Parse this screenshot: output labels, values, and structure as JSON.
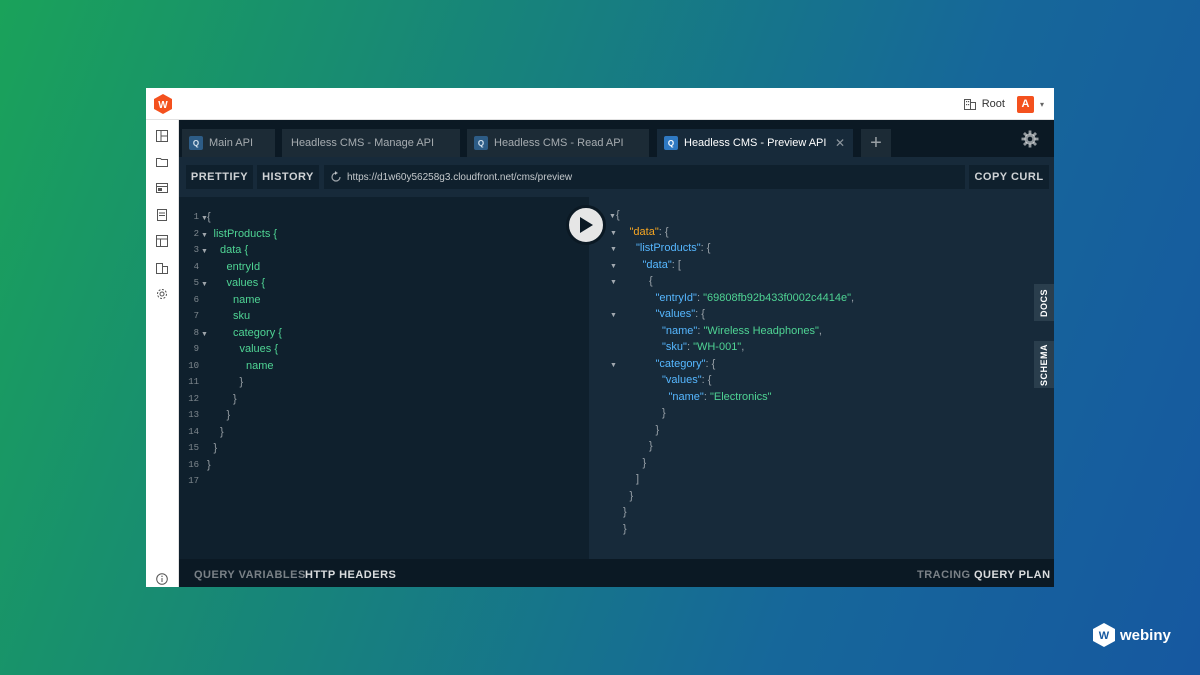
{
  "topbar": {
    "tenant_label": "Root",
    "avatar_initial": "A"
  },
  "tabs": [
    {
      "label": "Main API",
      "badge": "Q",
      "active": false
    },
    {
      "label": "Headless CMS - Manage API",
      "badge": "",
      "active": false
    },
    {
      "label": "Headless CMS - Read API",
      "badge": "Q",
      "active": false
    },
    {
      "label": "Headless CMS - Preview API",
      "badge": "Q",
      "active": true
    }
  ],
  "toolbar": {
    "prettify_label": "PRETTIFY",
    "history_label": "HISTORY",
    "url": "https://d1w60y56258g3.cloudfront.net/cms/preview",
    "copy_curl_label": "COPY CURL"
  },
  "query_editor": {
    "line_numbers": [
      "1",
      "2",
      "3",
      "4",
      "5",
      "6",
      "7",
      "8",
      "9",
      "10",
      "11",
      "12",
      "13",
      "14",
      "15",
      "16",
      "17"
    ],
    "lines": [
      {
        "text": "{",
        "folded": true
      },
      {
        "text": "listProducts {",
        "folded": true
      },
      {
        "text": "data {",
        "folded": true
      },
      {
        "text": "entryId",
        "folded": false
      },
      {
        "text": "values {",
        "folded": true
      },
      {
        "text": "name",
        "folded": false
      },
      {
        "text": "sku",
        "folded": false
      },
      {
        "text": "category {",
        "folded": true
      },
      {
        "text": "values {",
        "folded": false
      },
      {
        "text": "name",
        "folded": false
      },
      {
        "text": "}",
        "folded": false
      },
      {
        "text": "}",
        "folded": false
      },
      {
        "text": "}",
        "folded": false
      },
      {
        "text": "}",
        "folded": false
      },
      {
        "text": "}",
        "folded": false
      },
      {
        "text": "}",
        "folded": false
      },
      {
        "text": "",
        "folded": false
      }
    ]
  },
  "result": {
    "lines": [
      {
        "key": "",
        "value": "{"
      },
      {
        "key": "\"data\"",
        "value": ": {"
      },
      {
        "key": "\"listProducts\"",
        "value": ": {"
      },
      {
        "key": "\"data\"",
        "value": ": ["
      },
      {
        "key": "",
        "value": "{"
      },
      {
        "key": "\"entryId\"",
        "value": "\"69808fb92b433f0002c4414e\"",
        "suffix": ","
      },
      {
        "key": "\"values\"",
        "value": ": {"
      },
      {
        "key": "\"name\"",
        "value": "\"Wireless Headphones\"",
        "suffix": ","
      },
      {
        "key": "\"sku\"",
        "value": "\"WH-001\"",
        "suffix": ","
      },
      {
        "key": "\"category\"",
        "value": ": {"
      },
      {
        "key": "\"values\"",
        "value": ": {"
      },
      {
        "key": "\"name\"",
        "value": "\"Electronics\""
      },
      {
        "key": "",
        "value": "}"
      },
      {
        "key": "",
        "value": "}"
      },
      {
        "key": "",
        "value": "}"
      },
      {
        "key": "",
        "value": "}"
      },
      {
        "key": "",
        "value": "]"
      },
      {
        "key": "",
        "value": "}"
      },
      {
        "key": "",
        "value": "}"
      },
      {
        "key": "",
        "value": "}"
      }
    ]
  },
  "side_tabs": {
    "docs_label": "DOCS",
    "schema_label": "SCHEMA"
  },
  "footer": {
    "query_variables_label": "QUERY VARIABLES",
    "http_headers_label": "HTTP HEADERS",
    "tracing_label": "TRACING",
    "query_plan_label": "QUERY PLAN"
  },
  "brand": {
    "name": "webiny"
  },
  "colors": {
    "accent_orange": "#f4511e",
    "key_orange": "#f6a623",
    "key_blue": "#56b7ff",
    "string_green": "#4fd494",
    "editor_bg": "#0f202d"
  }
}
